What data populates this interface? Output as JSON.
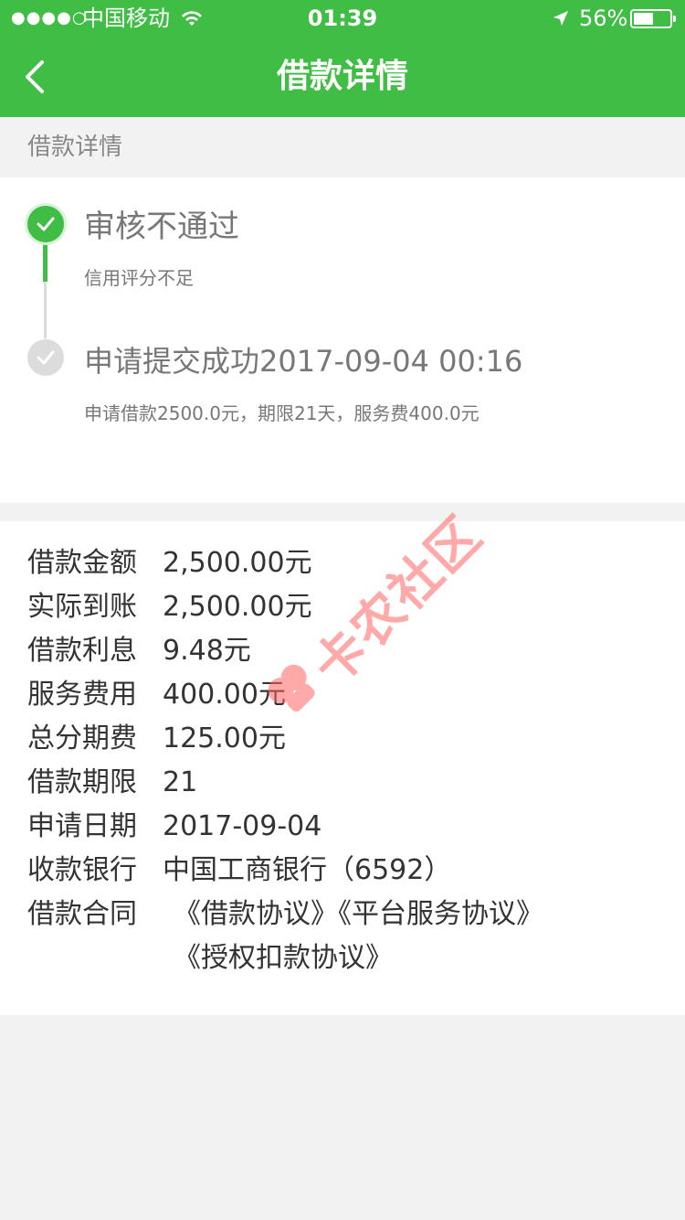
{
  "status_bar": {
    "signal": "●●●●○",
    "carrier": "中国移动",
    "time": "01:39",
    "battery": "56%",
    "battery_level": 0.56
  },
  "nav": {
    "title": "借款详情",
    "back_icon": "chevron-left-icon"
  },
  "section_header": "借款详情",
  "timeline": [
    {
      "title": "审核不通过",
      "subtitle": "信用评分不足",
      "state": "done",
      "color": "#3fbd44"
    },
    {
      "title": "申请提交成功2017-09-04 00:16",
      "subtitle": "申请借款2500.0元，期限21天，服务费400.0元",
      "state": "pending",
      "color": "#dcdcdc"
    }
  ],
  "details": [
    {
      "label": "借款金额",
      "value": "2,500.00元"
    },
    {
      "label": "实际到账",
      "value": "2,500.00元"
    },
    {
      "label": "借款利息",
      "value": "9.48元"
    },
    {
      "label": "服务费用",
      "value": "400.00元"
    },
    {
      "label": "总分期费",
      "value": "125.00元"
    },
    {
      "label": "借款期限",
      "value": "21"
    },
    {
      "label": "申请日期",
      "value": "2017-09-04"
    },
    {
      "label": "收款银行",
      "value": "中国工商银行（6592）"
    }
  ],
  "contract": {
    "label": "借款合同",
    "links": [
      "《借款协议》",
      "《平台服务协议》",
      "《授权扣款协议》"
    ]
  },
  "watermark": "卡农社区",
  "colors": {
    "brand_green": "#3fbd44",
    "watermark_red": "#ff6464"
  }
}
